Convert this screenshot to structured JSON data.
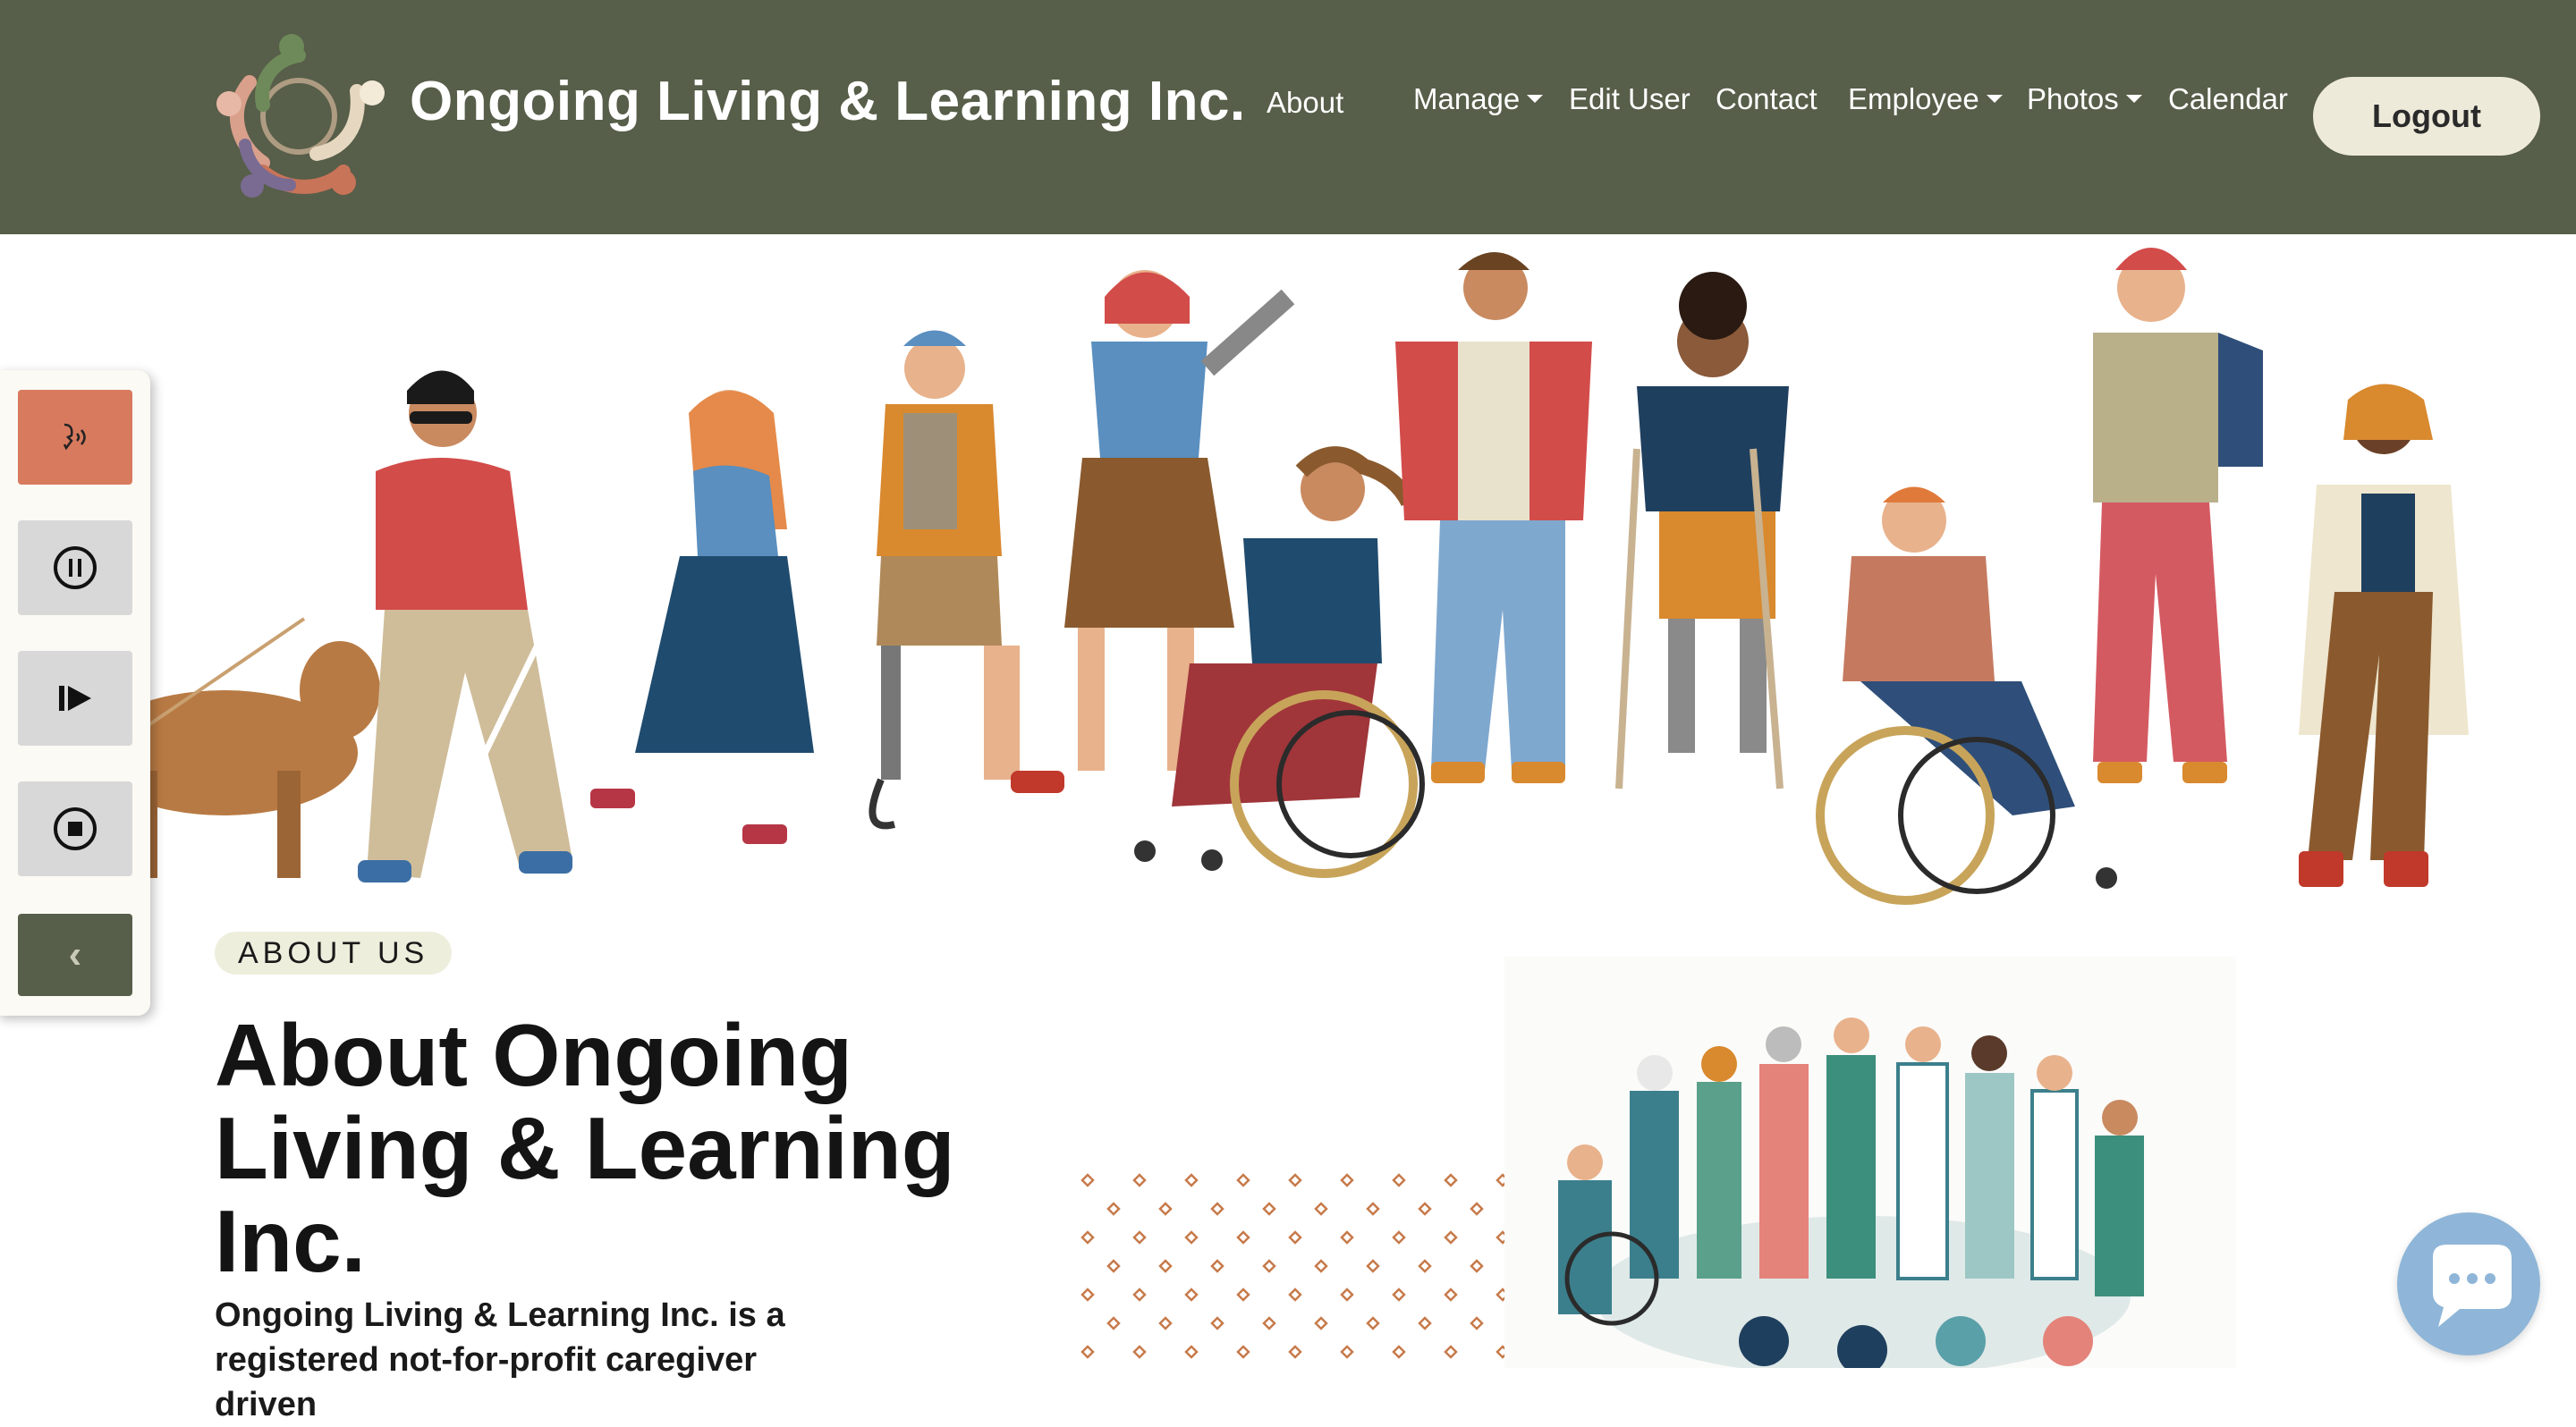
{
  "header": {
    "brand": "Ongoing Living & Learning Inc.",
    "logo_icon": "people-circle-logo-icon",
    "nav": [
      {
        "label": "About",
        "dropdown": false
      },
      {
        "label": "Manage",
        "dropdown": true
      },
      {
        "label": "Edit User",
        "dropdown": false
      },
      {
        "label": "Contact",
        "dropdown": false
      },
      {
        "label": "Employee",
        "dropdown": true
      },
      {
        "label": "Photos",
        "dropdown": true
      },
      {
        "label": "Calendar",
        "dropdown": false
      }
    ],
    "logout_label": "Logout"
  },
  "tts_panel": {
    "buttons": [
      "speak-icon",
      "pause-icon",
      "resume-icon",
      "stop-icon",
      "chevron-left-icon"
    ],
    "collapse_glyph": "‹"
  },
  "about": {
    "badge": "ABOUT US",
    "title": "About Ongoing Living & Learning Inc.",
    "text": "Ongoing Living & Learning Inc. is a registered not-for-profit caregiver driven"
  },
  "chat": {
    "icon": "chat-bubble-icon"
  },
  "colors": {
    "nav_bg": "#575e49",
    "logout_bg": "#eeead9",
    "speak_btn": "#d77a5e",
    "collapse_btn": "#575e49",
    "badge_bg": "#eeeedd",
    "chat_bg": "#8fb6d8"
  }
}
